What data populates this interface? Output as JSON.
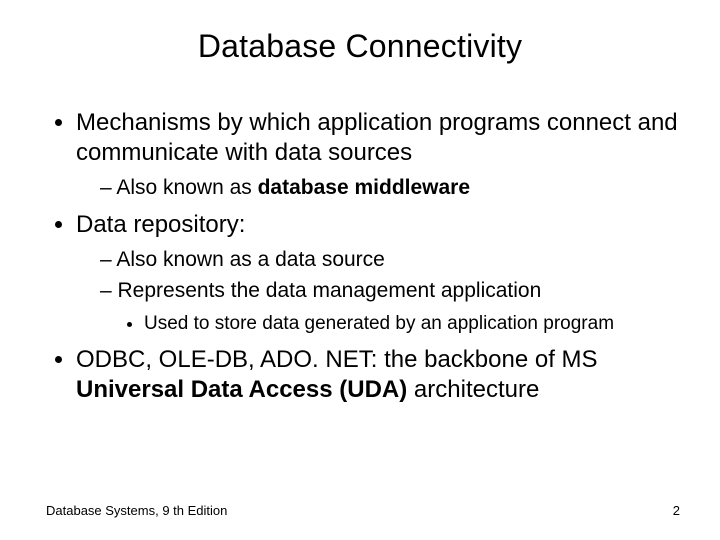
{
  "title": "Database Connectivity",
  "bullets": {
    "b1": "Mechanisms by which application programs connect and communicate with data sources",
    "b1s1a": "Also known as ",
    "b1s1b": "database middleware",
    "b2": "Data repository:",
    "b2s1": "Also known as a data source",
    "b2s2": "Represents the data management application",
    "b2s2s1": "Used to store data generated by an application program",
    "b3a": "ODBC, OLE-DB, ADO. NET: the backbone of MS ",
    "b3b": "Universal Data Access (UDA)",
    "b3c": " architecture"
  },
  "footer": {
    "left": "Database Systems, 9 th Edition",
    "right": "2"
  }
}
